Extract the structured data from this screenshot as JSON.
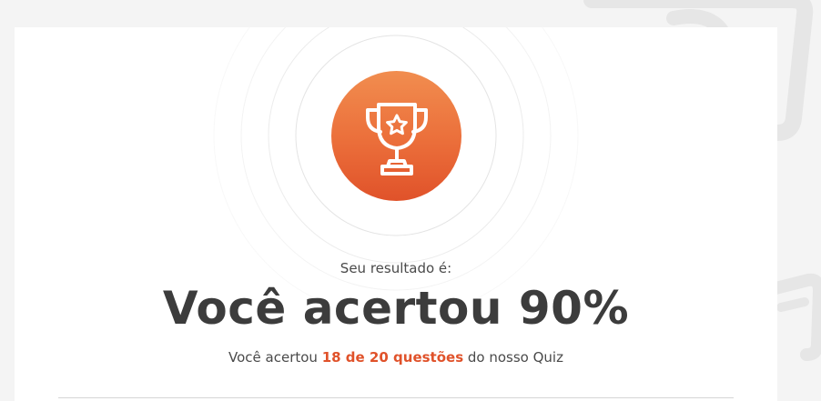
{
  "result": {
    "label": "Seu resultado é:",
    "title": "Você acertou 90%",
    "detail_prefix": "Você acertou ",
    "detail_highlight": "18 de 20 questões",
    "detail_suffix": " do nosso Quiz"
  },
  "badge": {
    "icon": "trophy-star-icon"
  },
  "colors": {
    "accent": "#e0522a",
    "badge_top": "#f18d4f",
    "badge_bottom": "#e0522a",
    "title_text": "#3c3c3c",
    "background": "#f4f4f4"
  }
}
